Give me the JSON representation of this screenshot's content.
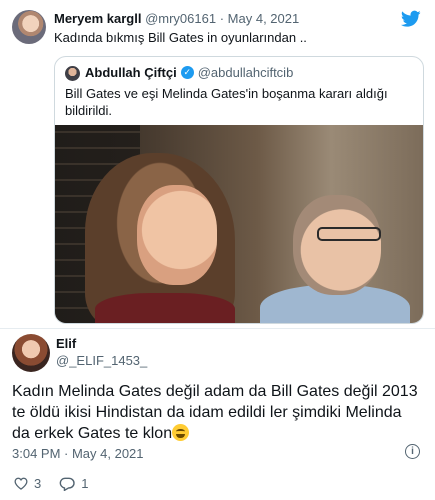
{
  "top_tweet": {
    "name": "Meryem kargll",
    "handle": "@mry06161",
    "separator": "·",
    "date": "May 4, 2021",
    "text": "Kadında bıkmış Bill Gates in oyunlarından .."
  },
  "quoted_tweet": {
    "name": "Abdullah Çiftçi",
    "handle": "@abdullahciftcib",
    "text": "Bill Gates ve eşi Melinda Gates'in boşanma kararı aldığı bildirildi."
  },
  "reply_tweet": {
    "name": "Elif",
    "handle": "@_ELIF_1453_",
    "text": "Kadın Melinda Gates değil adam da Bill Gates değil 2013 te öldü ikisi Hindistan da idam edildi ler şimdiki Melinda da erkek Gates te klon",
    "time": "3:04 PM · May 4, 2021",
    "likes": "3",
    "replies": "1"
  },
  "icons": {
    "brand": "twitter-bird-icon",
    "verified": "verified-badge-icon",
    "info": "info-icon",
    "like": "heart-icon",
    "reply": "comment-icon",
    "emoji": "grinning-face-icon"
  },
  "colors": {
    "accent": "#1d9bf0",
    "text": "#0f1419",
    "muted": "#536471",
    "border": "#cfd9de"
  }
}
